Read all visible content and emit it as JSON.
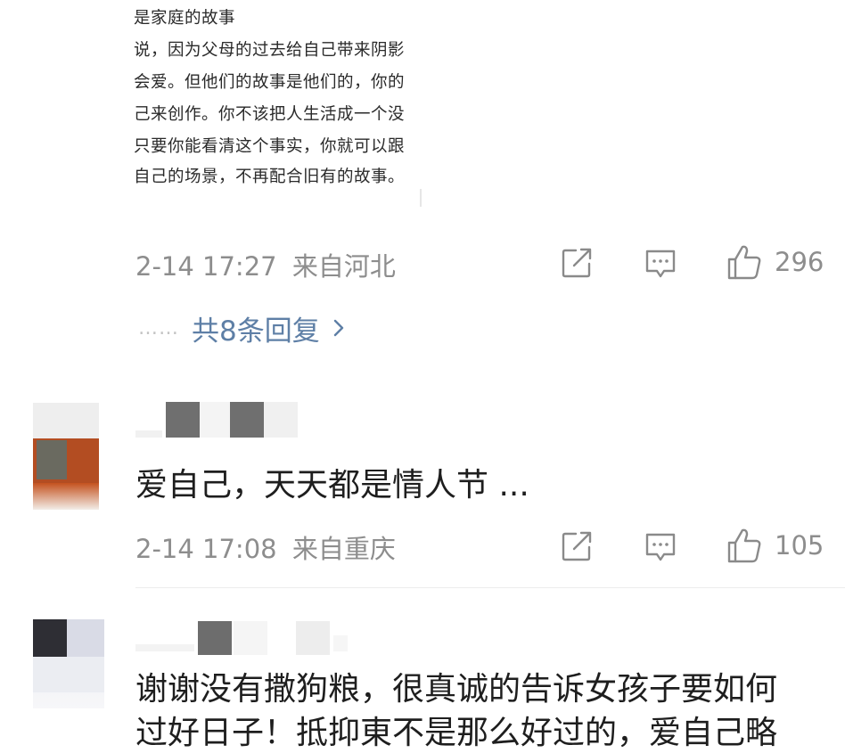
{
  "excerpt": {
    "lines": [
      "是家庭的故事",
      "说，因为父母的过去给自己带来阴影",
      "会爱。但他们的故事是他们的，你的",
      "己来创作。你不该把人生活成一个没",
      "只要你能看清这个事实，你就可以跟",
      "自己的场景，不再配合旧有的故事。"
    ]
  },
  "comments": [
    {
      "time": "2-14 17:27",
      "location": "来自河北",
      "likes": "296",
      "replies_label": "共8条回复",
      "replies_dots": "……"
    },
    {
      "text": "爱自己，天天都是情人节 ...",
      "time": "2-14 17:08",
      "location": "来自重庆",
      "likes": "105"
    },
    {
      "text": "谢谢没有撒狗粮，很真诚的告诉女孩子要如何",
      "text_line2": "过好日子！抵抑東不是那么好过的，爱自己略"
    }
  ],
  "icons": {
    "share": "share-icon",
    "comment": "comment-icon",
    "like": "thumbs-up-icon",
    "chevron": "chevron-right-icon"
  },
  "colors": {
    "meta_gray": "#8d8d8d",
    "link_blue": "#5e7fa6",
    "text_dark": "#1e1e1e"
  }
}
